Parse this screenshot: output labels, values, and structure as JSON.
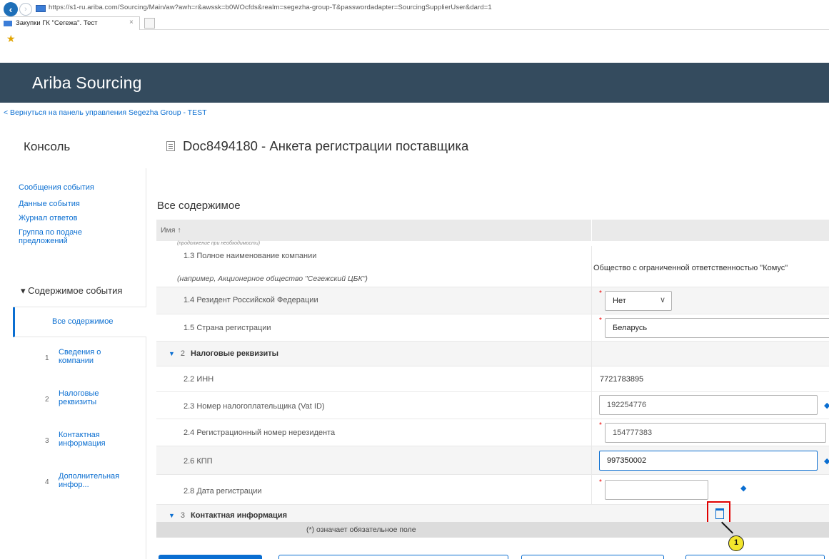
{
  "browser": {
    "url": "https://s1-ru.ariba.com/Sourcing/Main/aw?awh=r&awssk=b0WOcfds&realm=segezha-group-T&passwordadapter=SourcingSupplierUser&dard=1",
    "tab_title": "Закупки ГК \"Сегежа\". Тест",
    "tab_close": "×"
  },
  "app": {
    "title": "Ariba Sourcing",
    "back_link": "< Вернуться на панель управления Segezha Group - TEST"
  },
  "console": {
    "title": "Консоль",
    "doc_title": "Doc8494180 - Анкета регистрации поставщика"
  },
  "sidebar": {
    "links": [
      "Сообщения события",
      "Данные события",
      "Журнал ответов",
      "Группа по подаче предложений"
    ],
    "section_heading": "▾ Содержимое события",
    "active_item": "Все содержимое",
    "items": [
      {
        "num": "1",
        "label": "Сведения о компании"
      },
      {
        "num": "2",
        "label": "Налоговые реквизиты"
      },
      {
        "num": "3",
        "label": "Контактная информация"
      },
      {
        "num": "4",
        "label": "Дополнительная инфор..."
      }
    ]
  },
  "content": {
    "title": "Все содержимое",
    "column_name": "Имя ↑",
    "cut_top_text": "(продолжение при необходимости)",
    "rows": [
      {
        "label": "1.3  Полное наименование компании",
        "hint": "(например, Акционерное общество \"Сегежский ЦБК\")",
        "value": "Общество с ограниченной ответственностью \"Комус\""
      },
      {
        "label": "1.4  Резидент Российской Федерации",
        "value": "Нет"
      },
      {
        "label": "1.5  Страна регистрации",
        "value": "Беларусь"
      },
      {
        "group_num": "2",
        "group_label": "Налоговые реквизиты"
      },
      {
        "label": "2.2  ИНН",
        "value": "7721783895"
      },
      {
        "label": "2.3  Номер налогоплательщика (Vat ID)",
        "value": "192254776"
      },
      {
        "label": "2.4  Регистрационный номер нерезидента",
        "value": "154777383"
      },
      {
        "label": "2.6  КПП",
        "value": "997350002"
      },
      {
        "label": "2.8  Дата регистрации",
        "value": ""
      },
      {
        "group_num": "3",
        "group_label": "Контактная информация"
      }
    ],
    "footer_note": "(*) означает обязательное поле",
    "callout": "1"
  }
}
